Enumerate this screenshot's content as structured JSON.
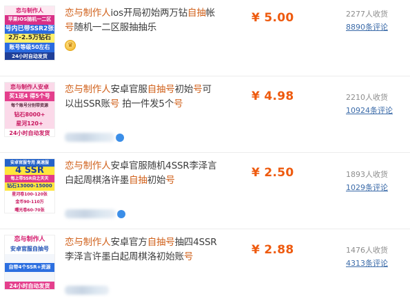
{
  "listings": [
    {
      "thumb": {
        "bg": "#fde8f1",
        "lines": [
          {
            "text": "恋与制作人",
            "color": "#d41c6e",
            "bg": "#fde8f1",
            "size": 8
          },
          {
            "text": "苹果IOS随机一二区",
            "color": "#ffffff",
            "bg": "#d92f86",
            "size": 7
          },
          {
            "text": "号内已带SSR2张",
            "color": "#ffffff",
            "bg": "#2a6be0",
            "size": 9
          },
          {
            "text": "2万-2.5万钻石",
            "color": "#2a2a2a",
            "bg": "#fff06a",
            "size": 9
          },
          {
            "text": "账号等级50左右",
            "color": "#ffffff",
            "bg": "#2a6be0",
            "size": 8
          },
          {
            "text": "24小时自动发货",
            "color": "#ffffff",
            "bg": "#1f3f98",
            "size": 7
          }
        ]
      },
      "title_segments": [
        {
          "text": "恋与制作人",
          "hl": true
        },
        {
          "text": "ios开局初始两万钻",
          "hl": false
        },
        {
          "text": "自抽",
          "hl": true
        },
        {
          "text": "帐",
          "hl": false
        },
        {
          "text": "号",
          "hl": true
        },
        {
          "text": "随机一二区服抽抽乐",
          "hl": false
        }
      ],
      "price": "¥ 5.00",
      "sold": "2277人收货",
      "reviews": "8890条评论"
    },
    {
      "thumb": {
        "bg": "#fbd9e9",
        "lines": [
          {
            "text": "恋与制作人安卓",
            "color": "#c8175f",
            "bg": "#fbd9e9",
            "size": 8
          },
          {
            "text": "买1送4 得5个号",
            "color": "#ffffff",
            "bg": "#e43f8c",
            "size": 8
          },
          {
            "text": "每个账号分别带资源",
            "color": "#5a2a40",
            "bg": "#fbd9e9",
            "size": 6
          },
          {
            "text": "钻石8000+",
            "color": "#c8175f",
            "bg": "#fbd9e9",
            "size": 8
          },
          {
            "text": "星河120+",
            "color": "#c8175f",
            "bg": "#fbd9e9",
            "size": 8
          },
          {
            "text": "24小时自动发货",
            "color": "#c8175f",
            "bg": "#ffffff",
            "size": 8
          }
        ]
      },
      "title_segments": [
        {
          "text": "恋与制作人",
          "hl": true
        },
        {
          "text": "安卓官服",
          "hl": false
        },
        {
          "text": "自抽号",
          "hl": true
        },
        {
          "text": "初始",
          "hl": false
        },
        {
          "text": "号",
          "hl": true
        },
        {
          "text": "可以出SSR账",
          "hl": false
        },
        {
          "text": "号",
          "hl": true
        },
        {
          "text": " 拍一件发5个",
          "hl": false
        },
        {
          "text": "号",
          "hl": true
        }
      ],
      "price": "¥ 4.98",
      "sold": "2210人收货",
      "reviews": "10924条评论"
    },
    {
      "thumb": {
        "bg": "#ffffff",
        "lines": [
          {
            "text": "安卓官服专用 高速服",
            "color": "#ffffff",
            "bg": "#2563c9",
            "size": 6
          },
          {
            "text": "4 SSR",
            "color": "#1d3f9a",
            "bg": "#ffe63c",
            "size": 13
          },
          {
            "text": "每上带SSR自之天天",
            "color": "#ffffff",
            "bg": "#e33a8a",
            "size": 6
          },
          {
            "text": "钻石13000-15000",
            "color": "#1d3f9a",
            "bg": "#ffe63c",
            "size": 7
          },
          {
            "text": "星河卷100-120张",
            "color": "#c8175f",
            "bg": "#ffffff",
            "size": 6
          },
          {
            "text": "金币90-110万",
            "color": "#c8175f",
            "bg": "#ffffff",
            "size": 6
          },
          {
            "text": "曙光卷60-70张",
            "color": "#c8175f",
            "bg": "#ffffff",
            "size": 6
          }
        ]
      },
      "title_segments": [
        {
          "text": "恋与制作人",
          "hl": true
        },
        {
          "text": "安卓官服随机4SSR李泽言白起周棋洛许墨",
          "hl": false
        },
        {
          "text": "自抽",
          "hl": true
        },
        {
          "text": "初始",
          "hl": false
        },
        {
          "text": "号",
          "hl": true
        }
      ],
      "price": "¥ 2.50",
      "sold": "1893人收货",
      "reviews": "1029条评论"
    },
    {
      "thumb": {
        "bg": "#eef4ff",
        "lines": [
          {
            "text": "恋与制作人",
            "color": "#d41c6e",
            "bg": "#ffffff",
            "size": 9
          },
          {
            "text": "安卓官服自抽号",
            "color": "#1d4fb3",
            "bg": "#ffffff",
            "size": 8
          },
          {
            "text": "",
            "color": "#1d4fb3",
            "bg": "#f3f6fb",
            "size": 8
          },
          {
            "text": "自带4个SSR+资源",
            "color": "#ffffff",
            "bg": "#2c6fe0",
            "size": 7
          },
          {
            "text": "",
            "color": "#1d4fb3",
            "bg": "#f3f6fb",
            "size": 6
          },
          {
            "text": "24小时自动发货",
            "color": "#ffffff",
            "bg": "#e43f8c",
            "size": 8
          }
        ]
      },
      "title_segments": [
        {
          "text": "恋与制作人",
          "hl": true
        },
        {
          "text": "安卓官方",
          "hl": false
        },
        {
          "text": "自抽号",
          "hl": true
        },
        {
          "text": "抽四4SSR李泽言许墨白起周棋洛初始账",
          "hl": false
        },
        {
          "text": "号",
          "hl": true
        }
      ],
      "price": "¥ 2.88",
      "sold": "1476人收货",
      "reviews": "4313条评论"
    }
  ],
  "colors": {
    "highlight": "#d0601a",
    "price": "#ee5a0e",
    "link": "#3a6aa8",
    "muted": "#8c8c8c"
  },
  "icons": {
    "seller_badge": "crown-badge-icon",
    "seller_tag": "blue-dot-icon"
  }
}
